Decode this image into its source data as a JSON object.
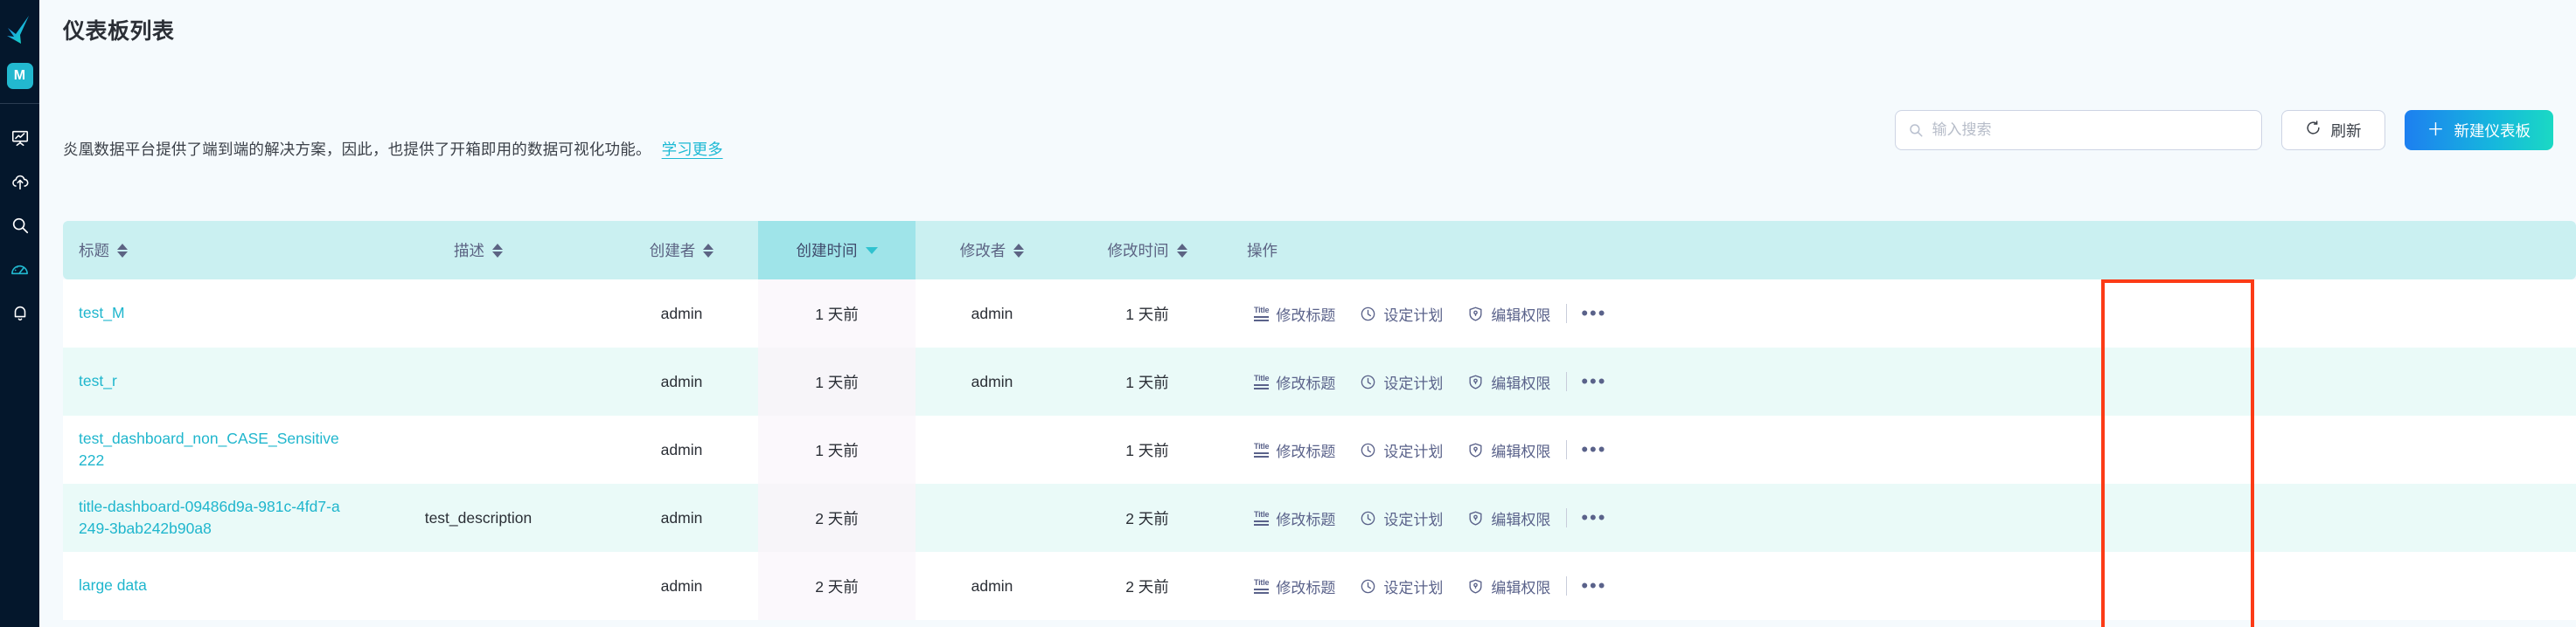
{
  "sidebar": {
    "logo_name": "bird-logo",
    "avatar_label": "M",
    "accent_color": "#22b8cf",
    "background_color": "#04172c",
    "items": [
      {
        "name": "presentation-chart-icon",
        "label": ""
      },
      {
        "name": "cloud-upload-icon",
        "label": ""
      },
      {
        "name": "search-icon",
        "label": ""
      },
      {
        "name": "gauge-dashboard-icon",
        "label": ""
      },
      {
        "name": "bell-icon",
        "label": ""
      }
    ]
  },
  "header": {
    "title": "仪表板列表",
    "description": "炎凰数据平台提供了端到端的解决方案，因此，也提供了开箱即用的数据可视化功能。",
    "learn_more": "学习更多",
    "search": {
      "value": "",
      "placeholder": "输入搜索"
    },
    "refresh_label": "刷新",
    "new_dashboard_label": "新建仪表板",
    "new_dashboard_plus": "＋",
    "gradient_from": "#1d7ff0",
    "gradient_to": "#1ad9c4"
  },
  "table": {
    "header_bg": "#caf0f1",
    "header_sorted_bg": "#9fe4e9",
    "columns": [
      {
        "label": "标题",
        "sort": "both"
      },
      {
        "label": "描述",
        "sort": "both"
      },
      {
        "label": "创建者",
        "sort": "both"
      },
      {
        "label": "创建时间",
        "sort": "desc"
      },
      {
        "label": "修改者",
        "sort": "both"
      },
      {
        "label": "修改时间",
        "sort": "both"
      },
      {
        "label": "操作",
        "sort": "none"
      }
    ],
    "actions": {
      "edit_title": "修改标题",
      "set_schedule": "设定计划",
      "edit_permission": "编辑权限",
      "more": "•••"
    },
    "rows": [
      {
        "title": "test_M",
        "description": "",
        "creator": "admin",
        "created": "1 天前",
        "modifier": "admin",
        "modified": "1 天前"
      },
      {
        "title": "test_r",
        "description": "",
        "creator": "admin",
        "created": "1 天前",
        "modifier": "admin",
        "modified": "1 天前"
      },
      {
        "title": "test_dashboard_non_CASE_Sensitive222",
        "description": "",
        "creator": "admin",
        "created": "1 天前",
        "modifier": "",
        "modified": "1 天前"
      },
      {
        "title": "title-dashboard-09486d9a-981c-4fd7-a249-3bab242b90a8",
        "description": "test_description",
        "creator": "admin",
        "created": "2 天前",
        "modifier": "",
        "modified": "2 天前"
      },
      {
        "title": "large data",
        "description": "",
        "creator": "admin",
        "created": "2 天前",
        "modifier": "admin",
        "modified": "2 天前"
      }
    ]
  },
  "annotation": {
    "highlight_color": "#fc3b16",
    "highlight_target": "设定计划"
  }
}
